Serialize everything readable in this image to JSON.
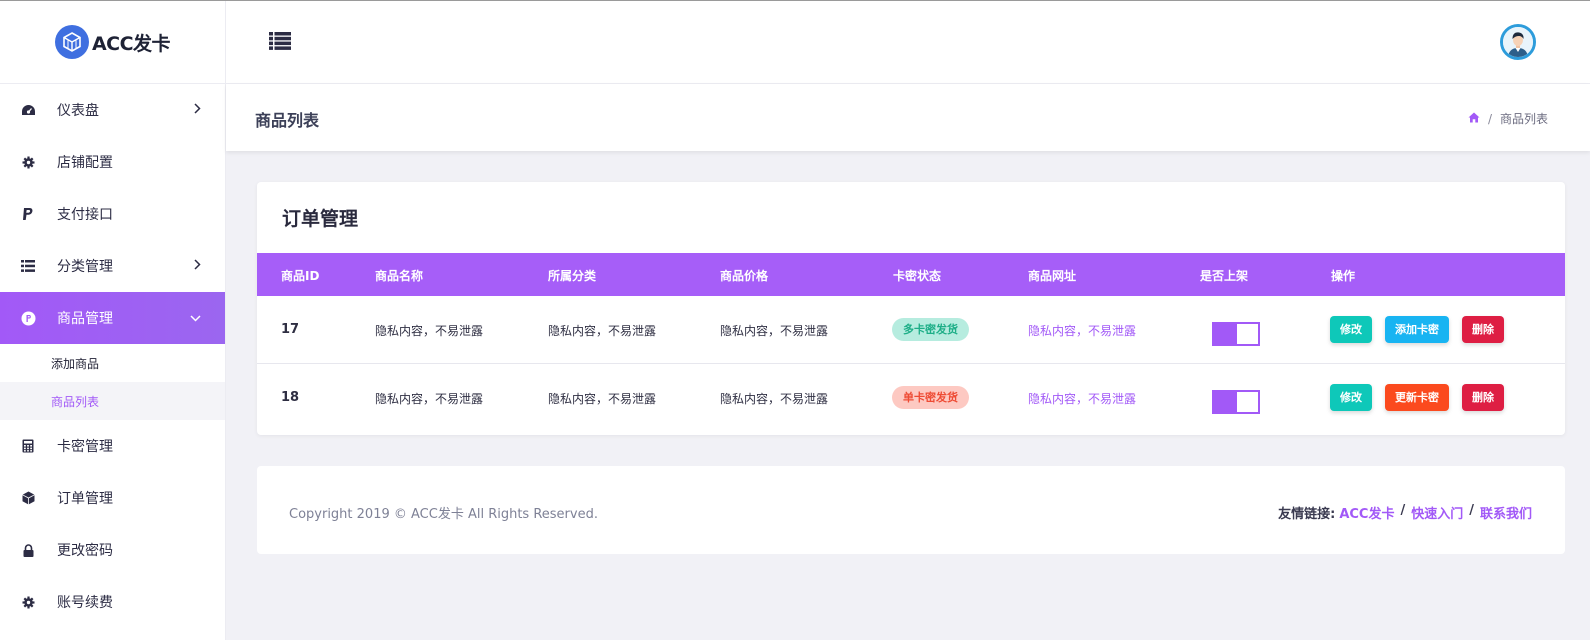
{
  "brand": {
    "name": "ACC发卡"
  },
  "sidebar": {
    "items": [
      {
        "label": "仪表盘",
        "icon": "dashboard-icon",
        "has_children": true
      },
      {
        "label": "店铺配置",
        "icon": "gear-icon",
        "has_children": false
      },
      {
        "label": "支付接口",
        "icon": "paypal-icon",
        "has_children": false
      },
      {
        "label": "分类管理",
        "icon": "list-icon",
        "has_children": true
      },
      {
        "label": "商品管理",
        "icon": "product-coin-icon",
        "has_children": true,
        "expanded": true
      },
      {
        "label": "卡密管理",
        "icon": "calculator-icon",
        "has_children": false
      },
      {
        "label": "订单管理",
        "icon": "cube-icon",
        "has_children": false
      },
      {
        "label": "更改密码",
        "icon": "lock-icon",
        "has_children": false
      },
      {
        "label": "账号续费",
        "icon": "gear-icon",
        "has_children": false
      }
    ],
    "subitems": [
      {
        "label": "添加商品"
      },
      {
        "label": "商品列表",
        "current": true
      }
    ]
  },
  "page": {
    "title": "商品列表",
    "breadcrumb": {
      "home_icon": "home-icon",
      "current": "商品列表"
    }
  },
  "card": {
    "title": "订单管理",
    "columns": [
      "商品ID",
      "商品名称",
      "所属分类",
      "商品价格",
      "卡密状态",
      "商品网址",
      "是否上架",
      "操作"
    ],
    "rows": [
      {
        "id": "17",
        "name": "隐私内容，不易泄露",
        "category": "隐私内容，不易泄露",
        "price": "隐私内容，不易泄露",
        "status": "多卡密发货",
        "url": "隐私内容，不易泄露",
        "listed": true,
        "actions": [
          "修改",
          "添加卡密",
          "删除"
        ]
      },
      {
        "id": "18",
        "name": "隐私内容，不易泄露",
        "category": "隐私内容，不易泄露",
        "price": "隐私内容，不易泄露",
        "status": "单卡密发货",
        "url": "隐私内容，不易泄露",
        "listed": true,
        "actions": [
          "修改",
          "更新卡密",
          "删除"
        ]
      }
    ]
  },
  "footer": {
    "copyright": "Copyright 2019 © ACC发卡 All Rights Reserved.",
    "links_label": "友情链接:",
    "links": [
      "ACC发卡",
      "快速入门",
      "联系我们"
    ],
    "separator": "/"
  },
  "colors": {
    "accent": "#a259f7",
    "status_multi": "#1dae87",
    "status_single": "#ee4b34",
    "btn_edit": "#0ec8b9",
    "btn_add": "#18b4f2",
    "btn_update": "#fb4a1e",
    "btn_delete": "#de1e43"
  }
}
